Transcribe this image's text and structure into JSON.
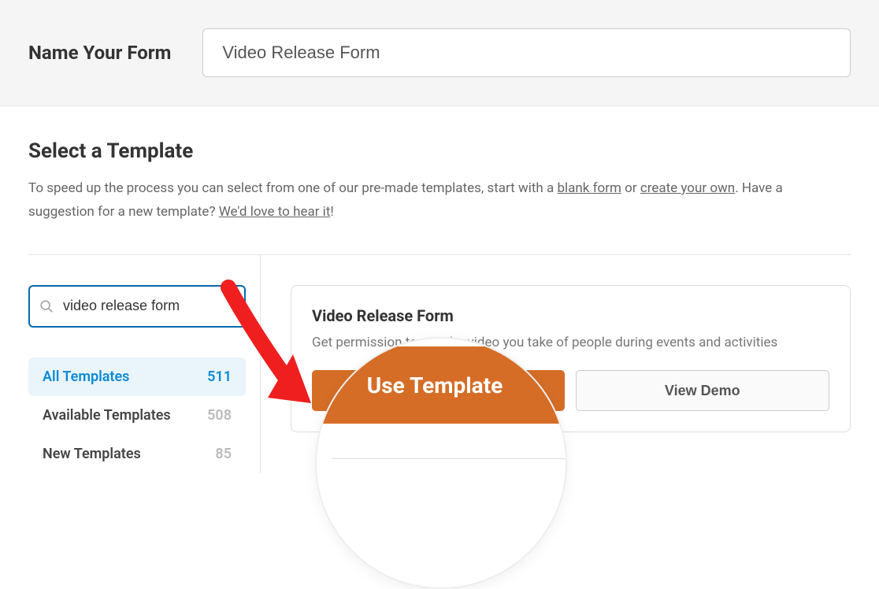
{
  "topbar": {
    "label": "Name Your Form",
    "value": "Video Release Form"
  },
  "section": {
    "title": "Select a Template",
    "desc_1": "To speed up the process you can select from one of our pre-made templates, start with a ",
    "link_blank": "blank form",
    "desc_2": " or ",
    "link_create": "create your own",
    "desc_3": ". Have a suggestion for a new template? ",
    "link_feedback": "We'd love to hear it",
    "desc_4": "!"
  },
  "search": {
    "value": "video release form"
  },
  "categories": [
    {
      "label": "All Templates",
      "count": "511",
      "active": true
    },
    {
      "label": "Available Templates",
      "count": "508",
      "active": false
    },
    {
      "label": "New Templates",
      "count": "85",
      "active": false
    }
  ],
  "template": {
    "title": "Video Release Form",
    "desc": "Get permission to use the video you take of people during events and activities",
    "use_label": "Use Template",
    "demo_label": "View Demo"
  },
  "zoom": {
    "use_label": "Use Template"
  }
}
